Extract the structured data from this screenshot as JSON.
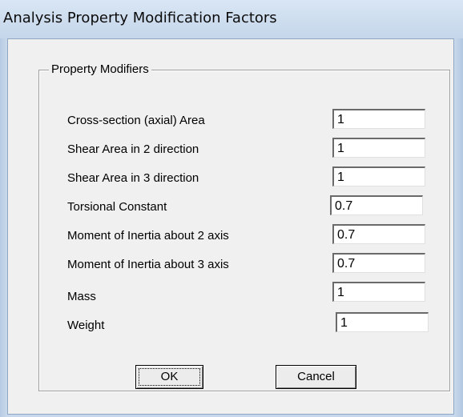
{
  "window": {
    "title": "Analysis Property Modification Factors"
  },
  "group": {
    "legend": "Property Modifiers"
  },
  "rows": [
    {
      "label": "Cross-section (axial) Area",
      "value": "1"
    },
    {
      "label": "Shear Area in 2 direction",
      "value": "1"
    },
    {
      "label": "Shear Area in 3 direction",
      "value": "1"
    },
    {
      "label": "Torsional Constant",
      "value": "0.7"
    },
    {
      "label": "Moment of Inertia about 2 axis",
      "value": "0.7"
    },
    {
      "label": "Moment of Inertia about 3 axis",
      "value": "0.7"
    },
    {
      "label": "Mass",
      "value": "1"
    },
    {
      "label": "Weight",
      "value": "1"
    }
  ],
  "buttons": {
    "ok_label": "OK",
    "cancel_label": "Cancel"
  },
  "colors": {
    "title_bar": "#c4d6ea",
    "dialog_face": "#f0f0f0"
  }
}
